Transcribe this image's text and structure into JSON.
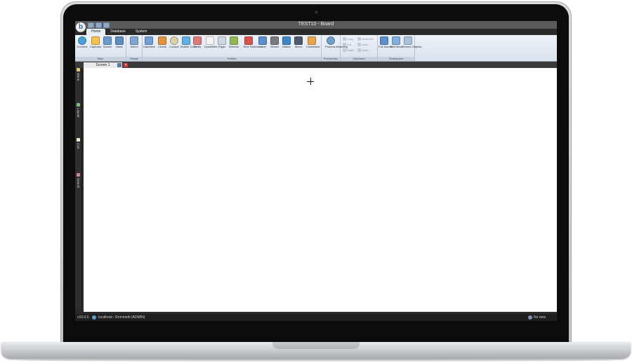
{
  "window": {
    "title": "TEST10 - Board",
    "logo_letter": "b"
  },
  "tabs": [
    "Home",
    "Database",
    "System"
  ],
  "ribbon": {
    "groups": [
      {
        "label": "Main",
        "buttons": [
          "Connect",
          "Captures",
          "Screen",
          "Mask"
        ]
      },
      {
        "label": "Range",
        "buttons": [
          "Select"
        ]
      },
      {
        "label": "Entities",
        "buttons": [
          "DataView",
          "Charts",
          "Cockpit",
          "Bubble Chart",
          "Trellis",
          "DynaWrite",
          "Pager",
          "Selector",
          "Time Selectors",
          "Label",
          "Viewer",
          "Button",
          "Menu",
          "Containers"
        ]
      },
      {
        "label": "Procedures",
        "buttons": [
          "Process Modeling"
        ]
      },
      {
        "label": "Clipboard",
        "buttons": [
          "Copy",
          "Cut",
          "Paste",
          "Select All",
          "Undo",
          "Redo"
        ]
      },
      {
        "label": "Workspace",
        "buttons": [
          "Full Screen",
          "Edit Mode",
          "Screen Objects"
        ]
      }
    ]
  },
  "document": {
    "tab_label": "Screen 1"
  },
  "sidebar": {
    "items": [
      "Menu",
      "Layout",
      "Cart",
      "Search"
    ]
  },
  "status": {
    "version": "v10.0.0",
    "server": "localhost - Rommetti (ADMIN)",
    "messages": "No new message"
  },
  "colors": {
    "ribbon": "#e3e9f2",
    "accent": "#2a5ea8"
  }
}
